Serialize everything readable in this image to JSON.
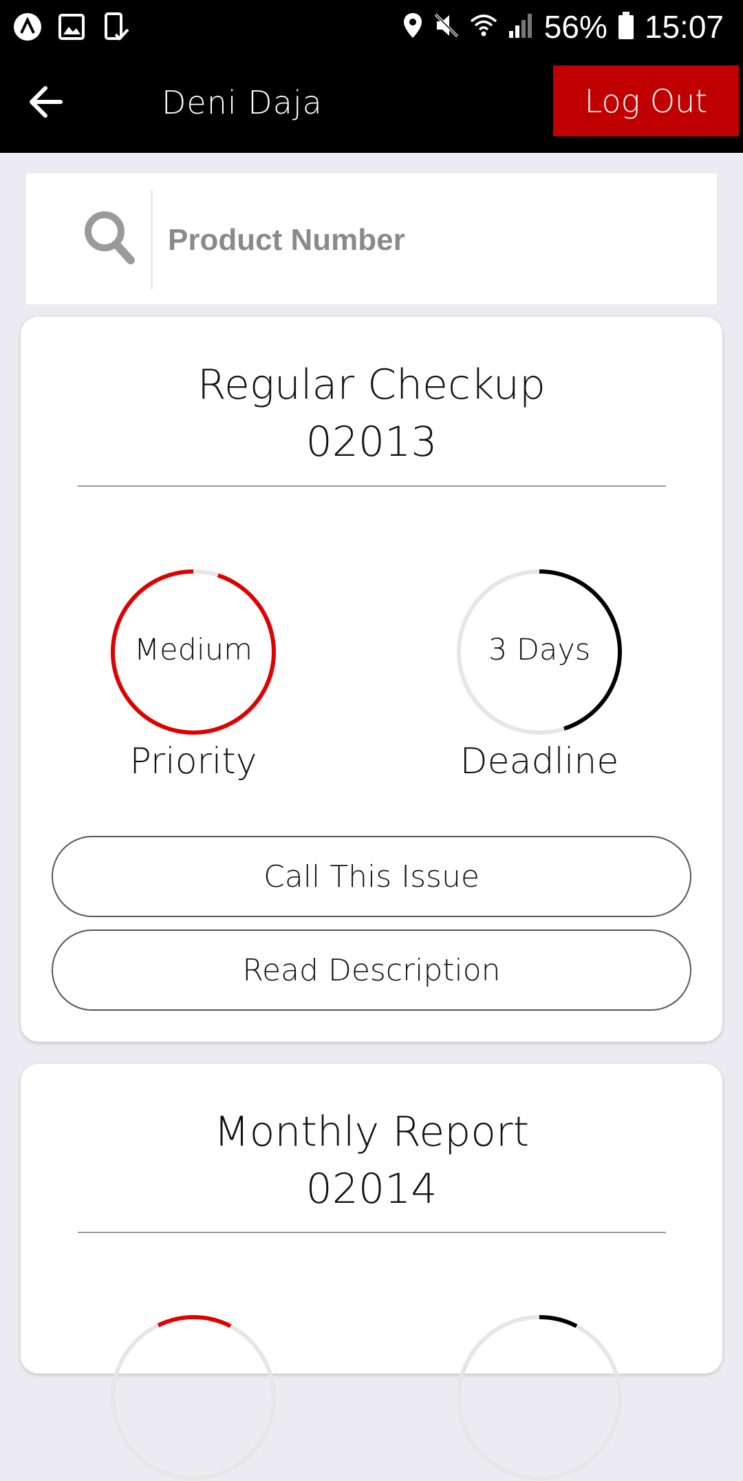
{
  "status_bar": {
    "battery": "56%",
    "time": "15:07",
    "left_icons": [
      "app-a-icon",
      "gallery-icon",
      "device-check-icon"
    ],
    "right_icons": [
      "location-icon",
      "mute-icon",
      "wifi-icon",
      "signal-icon",
      "battery-icon"
    ]
  },
  "app_bar": {
    "title": "Deni Daja",
    "logout_label": "Log Out",
    "back_icon": "arrow-left-icon"
  },
  "search": {
    "placeholder": "Product Number",
    "icon": "search-icon"
  },
  "colors": {
    "accent_red": "#c00000",
    "ring_red": "#e00000",
    "ring_black": "#000000",
    "ring_track": "#e6e6e6",
    "background": "#ebebf1"
  },
  "cards": [
    {
      "title": "Regular Checkup",
      "number": "02013",
      "priority_value": "Medium",
      "priority_label": "Priority",
      "priority_progress": 0.95,
      "deadline_value": "3 Days",
      "deadline_label": "Deadline",
      "deadline_progress": 0.45,
      "call_label": "Call This Issue",
      "read_label": "Read Description"
    },
    {
      "title": "Monthly Report",
      "number": "02014"
    }
  ]
}
